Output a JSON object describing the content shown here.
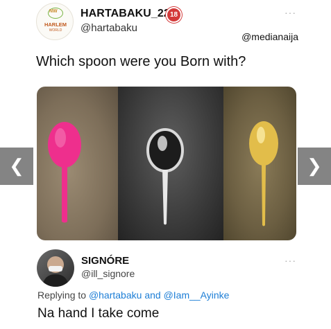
{
  "tweet": {
    "author": {
      "name": "HARTABAKU_225",
      "badge": "18",
      "handle": "@hartabaku",
      "avatar_logo_text": "NW",
      "avatar_brand_line1": "HARLEM",
      "avatar_brand_line2": "WORLD"
    },
    "more_icon": "···",
    "watermark": "@medianaija",
    "text": "Which spoon were you Born with?",
    "image": {
      "spoon_colors": [
        "#ee2f8d",
        "#e8e8e8",
        "#e2bd4a"
      ]
    }
  },
  "carousel": {
    "prev_glyph": "❮",
    "next_glyph": "❯"
  },
  "reply": {
    "author": {
      "name": "SIGNÓRE",
      "handle": "@ill_signore"
    },
    "more_icon": "···",
    "replying_prefix": "Replying to",
    "replying_to_1": "@hartabaku",
    "replying_and": "and",
    "replying_to_2": "@Iam__Ayinke",
    "text": "Na hand I take come"
  }
}
